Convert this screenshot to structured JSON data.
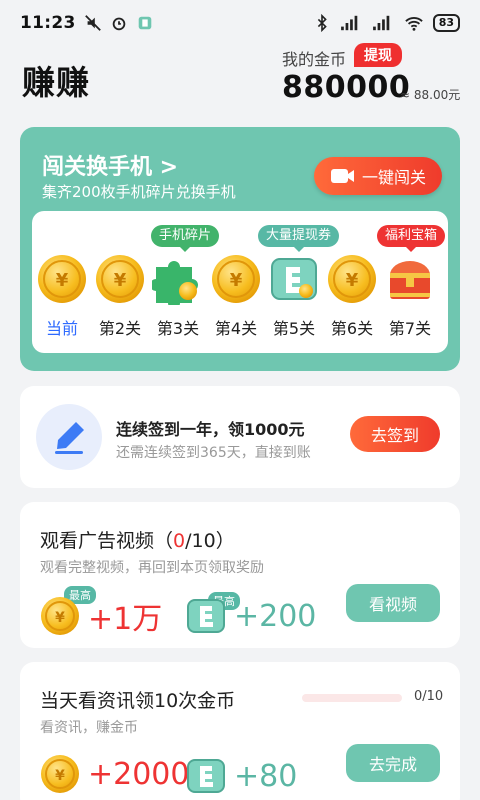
{
  "status_bar": {
    "time": "11:23",
    "battery": "83"
  },
  "header": {
    "app_title": "赚赚",
    "coins_label": "我的金币",
    "withdraw_label": "提现",
    "coins_value": "880000",
    "coins_rmb": "≈ 88.00元"
  },
  "challenge": {
    "title": "闯关换手机 >",
    "subtitle": "集齐200枚手机碎片兑换手机",
    "button_label": "一键闯关",
    "levels": [
      {
        "label": "当前",
        "icon": "gold-coin-icon",
        "current": true
      },
      {
        "label": "第2关",
        "icon": "gold-coin-icon"
      },
      {
        "label": "第3关",
        "icon": "puzzle-piece-icon",
        "tag": "手机碎片"
      },
      {
        "label": "第4关",
        "icon": "gold-coin-icon"
      },
      {
        "label": "第5关",
        "icon": "withdraw-voucher-icon",
        "tag": "大量提现券"
      },
      {
        "label": "第6关",
        "icon": "gold-coin-icon"
      },
      {
        "label": "第7关",
        "icon": "treasure-chest-icon",
        "tag": "福利宝箱"
      }
    ]
  },
  "signin": {
    "title": "连续签到一年，领1000元",
    "subtitle": "还需连续签到365天，直接到账",
    "button_label": "去签到"
  },
  "video_task": {
    "title_prefix": "观看广告视频（",
    "progress_done": "0",
    "title_suffix": "/10）",
    "subtitle": "观看完整视频，再回到本页领取奖励",
    "badge": "最高",
    "reward_coins": "+1万",
    "reward_voucher": "+200",
    "button_label": "看视频"
  },
  "news_task": {
    "title": "当天看资讯领10次金币",
    "progress_text": "0/10",
    "progress_fraction": 0,
    "subtitle": "看资讯，赚金币",
    "reward_coins": "+2000",
    "reward_voucher": "+80",
    "button_label": "去完成"
  },
  "colors": {
    "accent_red": "#ee3333",
    "teal": "#6fc6b0",
    "gold": "#f5b51b"
  }
}
